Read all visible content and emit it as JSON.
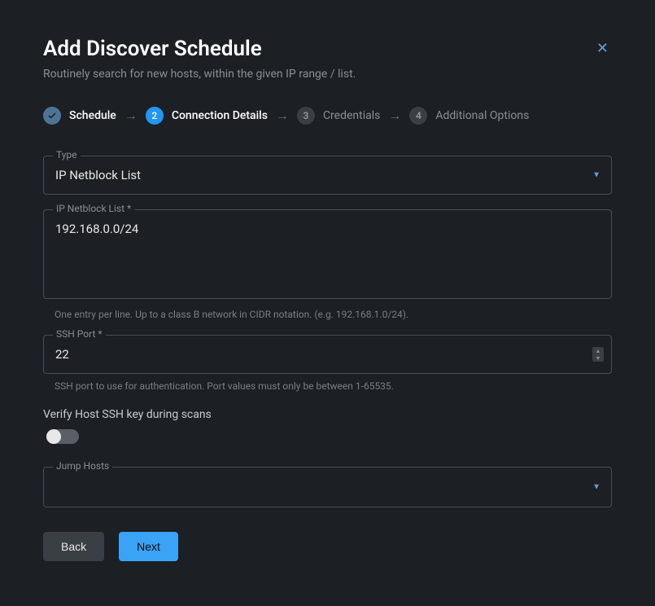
{
  "header": {
    "title": "Add Discover Schedule",
    "subtitle": "Routinely search for new hosts, within the given IP range / list."
  },
  "stepper": {
    "steps": [
      {
        "label": "Schedule",
        "state": "completed"
      },
      {
        "num": "2",
        "label": "Connection Details",
        "state": "active"
      },
      {
        "num": "3",
        "label": "Credentials",
        "state": "pending"
      },
      {
        "num": "4",
        "label": "Additional Options",
        "state": "pending"
      }
    ]
  },
  "form": {
    "type": {
      "label": "Type",
      "value": "IP Netblock List"
    },
    "netblock": {
      "label": "IP Netblock List *",
      "value": "192.168.0.0/24",
      "helper": "One entry per line. Up to a class B network in CIDR notation. (e.g. 192.168.1.0/24)."
    },
    "sshport": {
      "label": "SSH Port *",
      "value": "22",
      "helper": "SSH port to use for authentication. Port values must only be between 1-65535."
    },
    "verify": {
      "label": "Verify Host SSH key during scans",
      "enabled": false
    },
    "jumphosts": {
      "label": "Jump Hosts",
      "value": ""
    }
  },
  "buttons": {
    "back": "Back",
    "next": "Next"
  }
}
